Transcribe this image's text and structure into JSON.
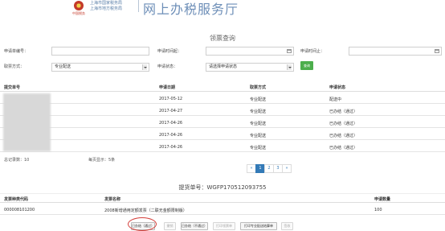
{
  "header": {
    "org_line1": "上海市国家税务局",
    "org_line2": "上海市地方税务局",
    "logo_sub": "中国税务",
    "title": "网上办税服务厅"
  },
  "page_title": "领票查询",
  "form": {
    "apply_no_label": "申请单编号：",
    "apply_no_value": "",
    "start_label": "申请时间起：",
    "start_value": "",
    "end_label": "申请时间止：",
    "end_value": "",
    "method_label": "取票方式：",
    "method_value": "专业配送",
    "status_label": "申请状态：",
    "status_value": "请选择申请状态",
    "query_button": "查询"
  },
  "table": {
    "headers": [
      "提交单号",
      "申请日期",
      "取票方式",
      "申请状态"
    ],
    "rows": [
      {
        "date": "2017-05-12",
        "method": "专业配送",
        "status": "配送中"
      },
      {
        "date": "2017-04-27",
        "method": "专业配送",
        "status": "已办结（通过）"
      },
      {
        "date": "2017-04-26",
        "method": "专业配送",
        "status": "已办结（通过）"
      },
      {
        "date": "2017-04-26",
        "method": "专业配送",
        "status": "已办结（通过）"
      },
      {
        "date": "2017-04-26",
        "method": "专业配送",
        "status": "已办结（通过）"
      }
    ]
  },
  "summary": {
    "total": "总记录数：10",
    "per_page": "每页显示：5条"
  },
  "pagination": {
    "prev": "«",
    "pages": [
      "1",
      "2",
      "3"
    ],
    "next": "»",
    "current": "1"
  },
  "invoice": {
    "label": "提货单号：WGFP170512093755",
    "headers": [
      "发票种类代码",
      "发票名称",
      "申请数量"
    ],
    "row": {
      "code": "000008101200",
      "name": "2008新增通用定额发票（二联无金额限制版）",
      "qty": "100"
    }
  },
  "actions": {
    "btn1": "已办结（通过）",
    "btn2": "撤销",
    "btn3": "已办结（不通过）",
    "btn4": "打印领票单",
    "btn5": "打印专业配送结算单",
    "btn6": "签收"
  },
  "colors": {
    "accent": "#337ab7",
    "query_button": "#4cae4c",
    "highlight": "#d43f3a",
    "header_title": "#6e8fb8"
  }
}
